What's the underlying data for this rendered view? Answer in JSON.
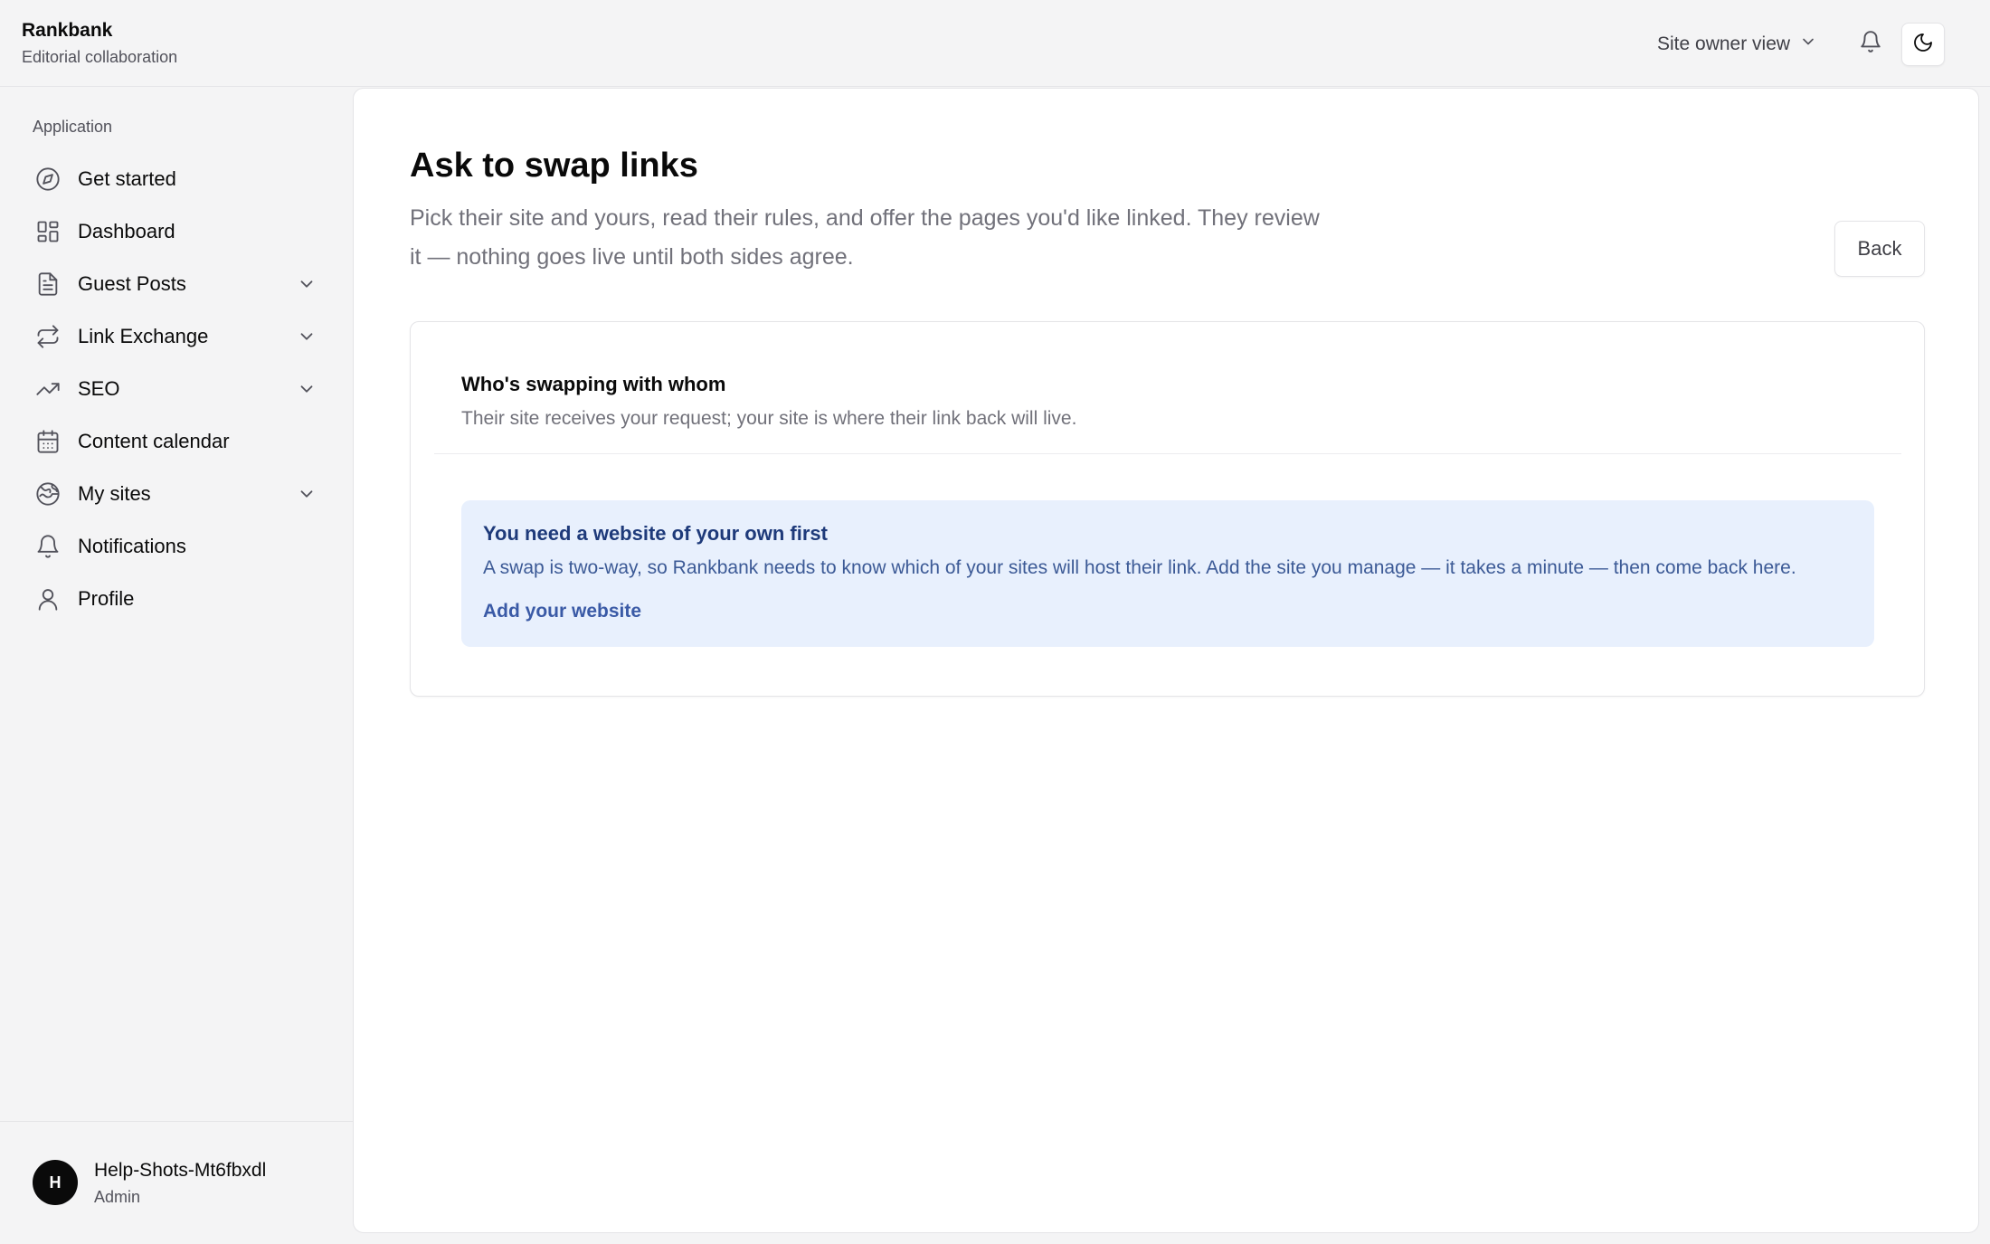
{
  "header": {
    "brand_name": "Rankbank",
    "brand_subtitle": "Editorial collaboration",
    "view_switch_label": "Site owner view"
  },
  "sidebar": {
    "group_label": "Application",
    "items": [
      {
        "label": "Get started",
        "icon": "compass-icon",
        "expandable": false
      },
      {
        "label": "Dashboard",
        "icon": "dashboard-grid-icon",
        "expandable": false
      },
      {
        "label": "Guest Posts",
        "icon": "document-icon",
        "expandable": true
      },
      {
        "label": "Link Exchange",
        "icon": "swap-arrows-icon",
        "expandable": true
      },
      {
        "label": "SEO",
        "icon": "trending-up-icon",
        "expandable": true
      },
      {
        "label": "Content calendar",
        "icon": "calendar-icon",
        "expandable": false
      },
      {
        "label": "My sites",
        "icon": "globe-icon",
        "expandable": true
      },
      {
        "label": "Notifications",
        "icon": "bell-icon",
        "expandable": false
      },
      {
        "label": "Profile",
        "icon": "user-icon",
        "expandable": false
      }
    ],
    "user": {
      "initial": "H",
      "name": "Help-Shots-Mt6fbxdl",
      "role": "Admin"
    }
  },
  "main": {
    "title": "Ask to swap links",
    "description": "Pick their site and yours, read their rules, and offer the pages you'd like linked. They review it — nothing goes live until both sides agree.",
    "back_label": "Back",
    "card": {
      "title": "Who's swapping with whom",
      "subtitle": "Their site receives your request; your site is where their link back will live.",
      "notice": {
        "title": "You need a website of your own first",
        "body": "A swap is two-way, so Rankbank needs to know which of your sites will host their link. Add the site you manage — it takes a minute — then come back here.",
        "link_label": "Add your website"
      }
    }
  },
  "colors": {
    "notice_bg": "#e8f0fd",
    "notice_title": "#1e3a7a",
    "notice_link": "#3a5aa6",
    "avatar_bg": "#0a0a0a"
  }
}
